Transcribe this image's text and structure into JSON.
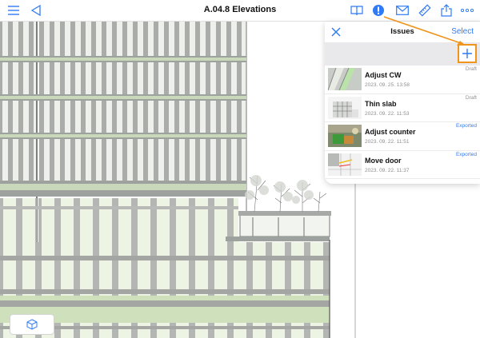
{
  "header": {
    "title": "A.04.8 Elevations",
    "left_icons": [
      "hamburger-menu-icon",
      "back-triangle-icon"
    ],
    "right_icons": [
      "book-icon",
      "issues-badge-icon",
      "mail-icon",
      "ruler-icon",
      "share-icon",
      "more-icon"
    ]
  },
  "issues_panel": {
    "title": "Issues",
    "close_icon": "close-x-icon",
    "select_label": "Select",
    "add_icon": "plus-icon",
    "items": [
      {
        "title": "Adjust CW",
        "date": "2023. 09. 25. 13:58",
        "status": "Draft"
      },
      {
        "title": "Thin slab",
        "date": "2023. 09. 22. 11:53",
        "status": "Draft"
      },
      {
        "title": "Adjust counter",
        "date": "2023. 09. 22. 11:51",
        "status": "Exported"
      },
      {
        "title": "Move door",
        "date": "2023. 09. 22. 11:37",
        "status": "Exported"
      }
    ]
  },
  "colors": {
    "accent": "#2f7bf5",
    "highlight": "#f0941c",
    "draft": "#8e8e93",
    "exported": "#2f7bf5"
  },
  "bottom_button_icon": "3d-cube-icon"
}
